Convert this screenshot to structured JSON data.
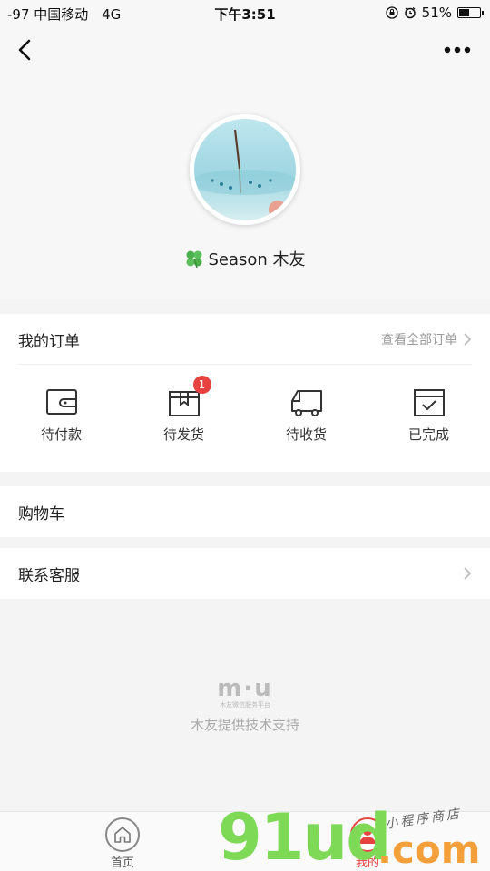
{
  "status_bar": {
    "carrier": "-97 中国移动",
    "network": "4G",
    "time": "下午3:51",
    "battery_text": "51%",
    "battery_level": 0.51
  },
  "nav": {
    "back_icon": "chevron-left-icon",
    "more_icon": "more-dots-icon"
  },
  "profile": {
    "username": "Season 木友",
    "emoji_icon": "four-leaf-clover-icon"
  },
  "orders": {
    "title": "我的订单",
    "view_all": "查看全部订单",
    "items": [
      {
        "label": "待付款",
        "icon": "wallet-icon"
      },
      {
        "label": "待发货",
        "icon": "package-icon",
        "badge": "1"
      },
      {
        "label": "待收货",
        "icon": "truck-icon"
      },
      {
        "label": "已完成",
        "icon": "completed-box-icon"
      }
    ]
  },
  "cart": {
    "label": "购物车"
  },
  "service": {
    "label": "联系客服"
  },
  "footer": {
    "logo": "m·u",
    "logo_sub": "木友微信服务平台",
    "support": "木友提供技术支持"
  },
  "tabs": [
    {
      "label": "首页",
      "icon": "home-icon"
    },
    {
      "label": "我的",
      "icon": "user-icon"
    }
  ],
  "watermark": {
    "brand": "91ud",
    "domain": ".com",
    "tagline": "小程序商店"
  },
  "colors": {
    "accent": "#e64340",
    "background": "#f4f4f4",
    "watermark_green": "#7ed957",
    "watermark_orange": "#f3a03a"
  }
}
